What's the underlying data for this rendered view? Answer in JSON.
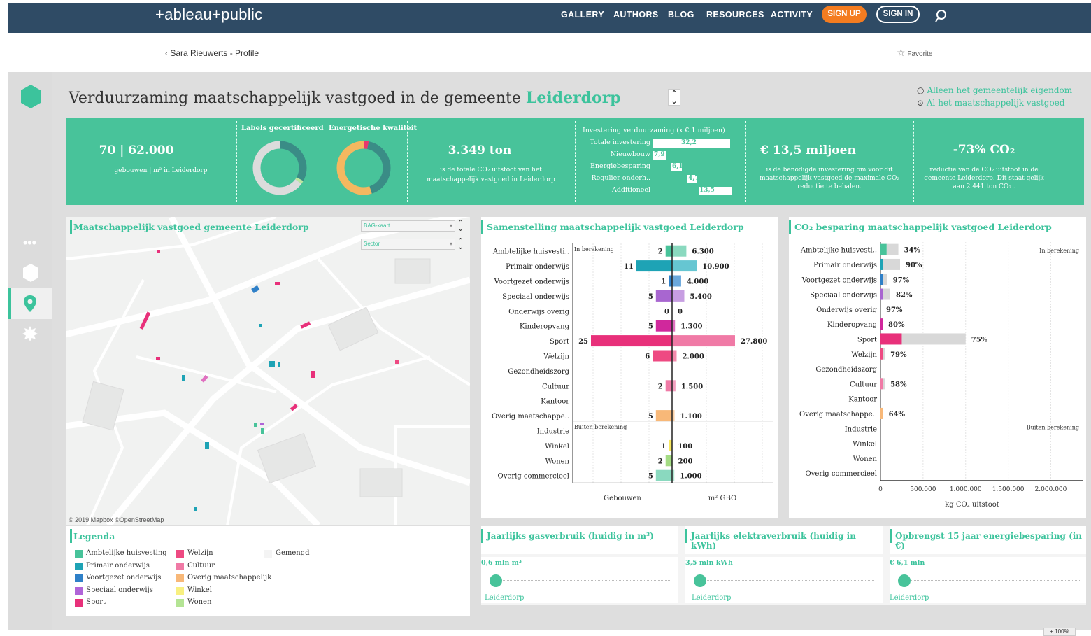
{
  "nav": {
    "logo": "+ableau+public",
    "links": [
      "GALLERY",
      "AUTHORS",
      "BLOG",
      "RESOURCES",
      "ACTIVITY"
    ],
    "signup": "SIGN UP",
    "signin": "SIGN IN"
  },
  "profile": {
    "back": "Sara Rieuwerts - Profile",
    "favorite": "Favorite"
  },
  "dashboard": {
    "title_prefix": "Verduurzaming maatschappelijk vastgoed in de gemeente",
    "title_city": "Leiderdorp",
    "radio": [
      {
        "label": "Alleen het gemeentelijk eigendom",
        "selected": false
      },
      {
        "label": "Al het maatschappelijk vastgoed",
        "selected": true
      }
    ]
  },
  "kpis": {
    "buildings": {
      "value": "70 | 62.000",
      "sub": "gebouwen | m² in Leiderdorp"
    },
    "labels_title": "Labels gecertificeerd",
    "quality_title": "Energetische kwaliteit",
    "co2": {
      "value": "3.349 ton",
      "sub1": "is de totale CO₂   uitstoot van het",
      "sub2": "maatschappelijk vastgoed in  Leiderdorp"
    },
    "investment": {
      "title": "Investering verduurzaming (x € 1 miljoen)",
      "rows": [
        {
          "label": "Totale investering",
          "value": "32,2",
          "amount": 32.2
        },
        {
          "label": "Nieuwbouw",
          "value": "7,9",
          "amount": 7.9
        },
        {
          "label": "Energiebesparing",
          "value": "6,1",
          "amount": 6.1
        },
        {
          "label": "Regulier onderh..",
          "value": "4,7",
          "amount": 4.7
        },
        {
          "label": "Additioneel",
          "value": "13,5",
          "amount": 13.5
        }
      ]
    },
    "needed": {
      "value": "€ 13,5 miljoen",
      "sub1": "is de benodigde investering om voor dit",
      "sub2": "maatschappelijk vastgoed de maximale CO₂",
      "sub3": "reductie te behalen."
    },
    "reduction": {
      "value": "-73% CO₂",
      "sub1": "reductie van de CO₂   uitstoot in de",
      "sub2": "gemeente Leiderdorp. Dit staat gelijk",
      "sub3": "aan 2.441 ton CO₂  ."
    }
  },
  "donuts": {
    "labels": [
      {
        "color": "#3a8c86",
        "fraction": 0.33
      },
      {
        "color": "#bfe6a0",
        "fraction": 0.02
      },
      {
        "color": "#dcdcdc",
        "fraction": 0.65
      }
    ],
    "quality": [
      {
        "color": "#e8386e",
        "fraction": 0.03
      },
      {
        "color": "#3a8c86",
        "fraction": 0.42
      },
      {
        "color": "#f4b860",
        "fraction": 0.55
      }
    ]
  },
  "map": {
    "title": "Maatschappelijk vastgoed gemeente Leiderdorp",
    "dropdown1": "BAG-kaart",
    "dropdown2": "Sector",
    "attribution": "© 2019 Mapbox  ©OpenStreetMap"
  },
  "legend": {
    "title": "Legenda",
    "items": [
      {
        "label": "Ambtelijke huisvesting",
        "color": "#48c39a"
      },
      {
        "label": "Primair onderwijs",
        "color": "#1ea3b5"
      },
      {
        "label": "Voortgezet onderwijs",
        "color": "#2f80c8"
      },
      {
        "label": "Speciaal onderwijs",
        "color": "#b064d8"
      },
      {
        "label": "Sport",
        "color": "#e8307a"
      },
      {
        "label": "Welzijn",
        "color": "#ee4a82"
      },
      {
        "label": "Cultuur",
        "color": "#f07aa6"
      },
      {
        "label": "Overig maatschappelijk",
        "color": "#f8b878"
      },
      {
        "label": "Winkel",
        "color": "#f8f080"
      },
      {
        "label": "Wonen",
        "color": "#b4e494"
      },
      {
        "label": "Gemengd",
        "color": "#f4f4f4"
      }
    ]
  },
  "samenstelling": {
    "title": "Samenstelling maatschappelijk vastgoed Leiderdorp",
    "note_in": "In berekening",
    "note_out": "Buiten berekening",
    "axis_left": "Gebouwen",
    "axis_right": "m² GBO",
    "rows": [
      {
        "label": "Ambtelijke huisvesti..",
        "count": 2,
        "count_label": "2",
        "area": 6300,
        "area_label": "6.300",
        "color": "#48c39a",
        "color2": "#8ad9bf"
      },
      {
        "label": "Primair onderwijs",
        "count": 11,
        "count_label": "11",
        "area": 10900,
        "area_label": "10.900",
        "color": "#1ea3b5",
        "color2": "#66c6d2"
      },
      {
        "label": "Voortgezet onderwijs",
        "count": 1,
        "count_label": "1",
        "area": 4000,
        "area_label": "4.000",
        "color": "#2f80c8",
        "color2": "#6aa8dc"
      },
      {
        "label": "Speciaal onderwijs",
        "count": 5,
        "count_label": "5",
        "area": 5400,
        "area_label": "5.400",
        "color": "#a866d0",
        "color2": "#c79ee2"
      },
      {
        "label": "Onderwijs overig",
        "count": 0,
        "count_label": "0",
        "area": 0,
        "area_label": "0",
        "color": "#999999",
        "color2": "#bbbbbb"
      },
      {
        "label": "Kinderopvang",
        "count": 5,
        "count_label": "5",
        "area": 1300,
        "area_label": "1.300",
        "color": "#d0289c",
        "color2": "#e070c0"
      },
      {
        "label": "Sport",
        "count": 25,
        "count_label": "25",
        "area": 27800,
        "area_label": "27.800",
        "color": "#e8307a",
        "color2": "#f07aa6"
      },
      {
        "label": "Welzijn",
        "count": 6,
        "count_label": "6",
        "area": 2000,
        "area_label": "2.000",
        "color": "#ee4a82",
        "color2": "#f48aac"
      },
      {
        "label": "Gezondheidszorg",
        "count": null,
        "count_label": "",
        "area": null,
        "area_label": "",
        "color": "#999999",
        "color2": "#bbbbbb"
      },
      {
        "label": "Cultuur",
        "count": 2,
        "count_label": "2",
        "area": 1500,
        "area_label": "1.500",
        "color": "#f07aa6",
        "color2": "#f4a0c0"
      },
      {
        "label": "Kantoor",
        "count": null,
        "count_label": "",
        "area": null,
        "area_label": "",
        "color": "#999999",
        "color2": "#bbbbbb"
      },
      {
        "label": "Overig maatschappe..",
        "count": 5,
        "count_label": "5",
        "area": 1100,
        "area_label": "1.100",
        "color": "#f8b878",
        "color2": "#fbd0a6"
      },
      {
        "label": "Industrie",
        "count": null,
        "count_label": "",
        "area": null,
        "area_label": "",
        "color": "#999999",
        "color2": "#bbbbbb"
      },
      {
        "label": "Winkel",
        "count": 1,
        "count_label": "1",
        "area": 100,
        "area_label": "100",
        "color": "#f8e860",
        "color2": "#faf0a0"
      },
      {
        "label": "Wonen",
        "count": 2,
        "count_label": "2",
        "area": 200,
        "area_label": "200",
        "color": "#a4dc84",
        "color2": "#c4eaa8"
      },
      {
        "label": "Overig commercieel",
        "count": 5,
        "count_label": "5",
        "area": 1000,
        "area_label": "1.000",
        "color": "#8ad9bf",
        "color2": "#b0e6d2"
      }
    ]
  },
  "co2besparing": {
    "title": "CO₂   besparing maatschappelijk vastgoed Leiderdorp",
    "note_in": "In berekening",
    "note_out": "Buiten berekening",
    "xlabel": "kg CO₂   uitstoot",
    "ticks": [
      "0",
      "500.000",
      "1.000.000",
      "1.500.000",
      "2.000.000"
    ],
    "xmax": 2300000,
    "rows": [
      {
        "label": "Ambtelijke huisvesti..",
        "total": 210000,
        "saved_pct": 34,
        "pct_label": "34%",
        "color": "#48c39a"
      },
      {
        "label": "Primair onderwijs",
        "total": 230000,
        "saved_pct": 10,
        "pct_label": "90%",
        "color": "#1ea3b5"
      },
      {
        "label": "Voortgezet onderwijs",
        "total": 80000,
        "saved_pct": 3,
        "pct_label": "97%",
        "color": "#2f80c8"
      },
      {
        "label": "Speciaal onderwijs",
        "total": 115000,
        "saved_pct": 18,
        "pct_label": "82%",
        "color": "#a866d0"
      },
      {
        "label": "Onderwijs overig",
        "total": 0,
        "saved_pct": 0,
        "pct_label": "97%",
        "color": "#999999"
      },
      {
        "label": "Kinderopvang",
        "total": 25000,
        "saved_pct": 20,
        "pct_label": "80%",
        "color": "#d0289c"
      },
      {
        "label": "Sport",
        "total": 1000000,
        "saved_pct": 25,
        "pct_label": "75%",
        "color": "#e8307a"
      },
      {
        "label": "Welzijn",
        "total": 50000,
        "saved_pct": 21,
        "pct_label": "79%",
        "color": "#ee4a82"
      },
      {
        "label": "Gezondheidszorg",
        "total": 0,
        "saved_pct": 0,
        "pct_label": "",
        "color": "#999999"
      },
      {
        "label": "Cultuur",
        "total": 50000,
        "saved_pct": 42,
        "pct_label": "58%",
        "color": "#f07aa6"
      },
      {
        "label": "Kantoor",
        "total": 0,
        "saved_pct": 0,
        "pct_label": "",
        "color": "#999999"
      },
      {
        "label": "Overig maatschappe..",
        "total": 30000,
        "saved_pct": 36,
        "pct_label": "64%",
        "color": "#f8b878"
      },
      {
        "label": "Industrie",
        "total": 0,
        "saved_pct": 0,
        "pct_label": "",
        "color": "#999999"
      },
      {
        "label": "Winkel",
        "total": 0,
        "saved_pct": 0,
        "pct_label": "",
        "color": "#999999"
      },
      {
        "label": "Wonen",
        "total": 0,
        "saved_pct": 0,
        "pct_label": "",
        "color": "#999999"
      },
      {
        "label": "Overig commercieel",
        "total": 0,
        "saved_pct": 0,
        "pct_label": "",
        "color": "#999999"
      }
    ]
  },
  "sliders": [
    {
      "title": "Jaarlijks gasverbruik (huidig in m³)",
      "value": "0,6 mln m³",
      "location": "Leiderdorp"
    },
    {
      "title": "Jaarlijks elektraverbruik (huidig in kWh)",
      "value": "3,5 mln kWh",
      "location": "Leiderdorp"
    },
    {
      "title": "Opbrengst 15 jaar energiebesparing (in €)",
      "value": "€ 6,1 mln",
      "location": "Leiderdorp"
    }
  ],
  "zoom": "100%"
}
